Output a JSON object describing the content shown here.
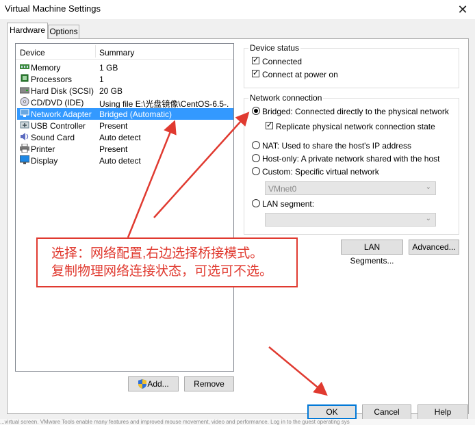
{
  "window": {
    "title": "Virtual Machine Settings",
    "close_glyph": "✕"
  },
  "tabs": [
    {
      "label": "Hardware",
      "active": true
    },
    {
      "label": "Options",
      "active": false
    }
  ],
  "device_list": {
    "header": {
      "device": "Device",
      "summary": "Summary"
    },
    "rows": [
      {
        "icon": "memory-icon",
        "device": "Memory",
        "summary": "1 GB"
      },
      {
        "icon": "processor-icon",
        "device": "Processors",
        "summary": "1"
      },
      {
        "icon": "hard-disk-icon",
        "device": "Hard Disk (SCSI)",
        "summary": "20 GB"
      },
      {
        "icon": "cd-dvd-icon",
        "device": "CD/DVD (IDE)",
        "summary": "Using file E:\\光盘镜像\\CentOS-6.5-..."
      },
      {
        "icon": "network-adapter-icon",
        "device": "Network Adapter",
        "summary": "Bridged (Automatic)",
        "selected": true
      },
      {
        "icon": "usb-icon",
        "device": "USB Controller",
        "summary": "Present"
      },
      {
        "icon": "sound-card-icon",
        "device": "Sound Card",
        "summary": "Auto detect"
      },
      {
        "icon": "printer-icon",
        "device": "Printer",
        "summary": "Present"
      },
      {
        "icon": "display-icon",
        "device": "Display",
        "summary": "Auto detect"
      }
    ]
  },
  "buttons": {
    "add": "Add...",
    "remove": "Remove",
    "lan_segments": "LAN Segments...",
    "advanced": "Advanced...",
    "ok": "OK",
    "cancel": "Cancel",
    "help": "Help"
  },
  "device_status": {
    "title": "Device status",
    "connected": {
      "label": "Connected",
      "checked": true
    },
    "connect_at_power_on": {
      "label": "Connect at power on",
      "checked": true
    }
  },
  "network_connection": {
    "title": "Network connection",
    "bridged": {
      "label": "Bridged: Connected directly to the physical network",
      "selected": true
    },
    "replicate": {
      "label": "Replicate physical network connection state",
      "checked": true
    },
    "nat": {
      "label": "NAT: Used to share the host's IP address",
      "selected": false
    },
    "host_only": {
      "label": "Host-only: A private network shared with the host",
      "selected": false
    },
    "custom": {
      "label": "Custom: Specific virtual network",
      "selected": false
    },
    "custom_value": "VMnet0",
    "lan_segment": {
      "label": "LAN segment:",
      "selected": false
    },
    "lan_segment_value": ""
  },
  "annotation": {
    "line1": "选择：网络配置,右边选择桥接模式。",
    "line2": "复制物理网络连接状态，可选可不选。",
    "color": "#e03a30"
  },
  "background_strip": "...virtual screen. VMware Tools enable many features and improved mouse movement, video and performance. Log in to the guest operating sys"
}
